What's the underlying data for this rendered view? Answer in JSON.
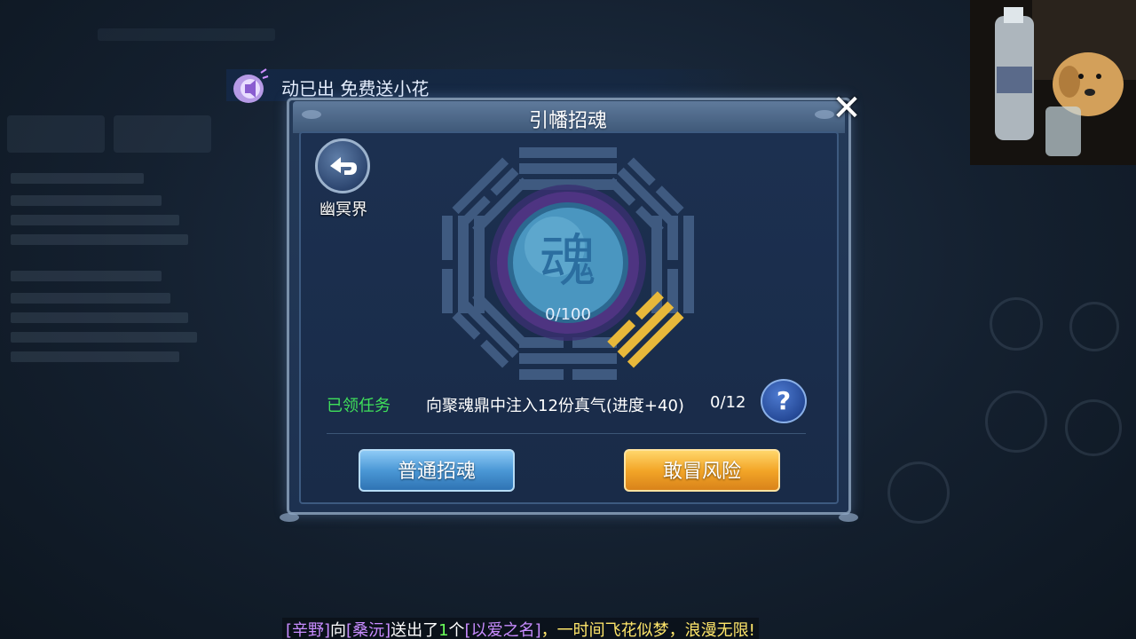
{
  "announcement": {
    "text": "动已出 免费送小花"
  },
  "dialog": {
    "title": "引幡招魂",
    "close_symbol": "✕",
    "back_label": "幽冥界",
    "soul_glyph": "魂",
    "progress": "0/100",
    "task": {
      "status": "已领任务",
      "description": "向聚魂鼎中注入12份真气(进度+40)",
      "count": "0/12"
    },
    "help_symbol": "?",
    "buttons": {
      "normal": "普通招魂",
      "risk": "敢冒风险"
    }
  },
  "chat": {
    "sender": "[辛野]",
    "to_word": "向",
    "receiver": "[桑沅]",
    "sent_word": "送出了",
    "quantity": "1",
    "unit": "个",
    "item": "[以爱之名]",
    "tail": "，一时间飞花似梦，浪漫无限!"
  },
  "colors": {
    "task_status": "#3fe05a",
    "button_normal": "#4b98d6",
    "button_risk": "#f3a628",
    "chat_name": "#c88cff",
    "chat_highlight": "#ffe66a"
  },
  "icons": [
    "speaker-icon",
    "back-arrow-icon",
    "close-icon",
    "help-icon",
    "bagua-icon",
    "soul-orb-icon"
  ]
}
